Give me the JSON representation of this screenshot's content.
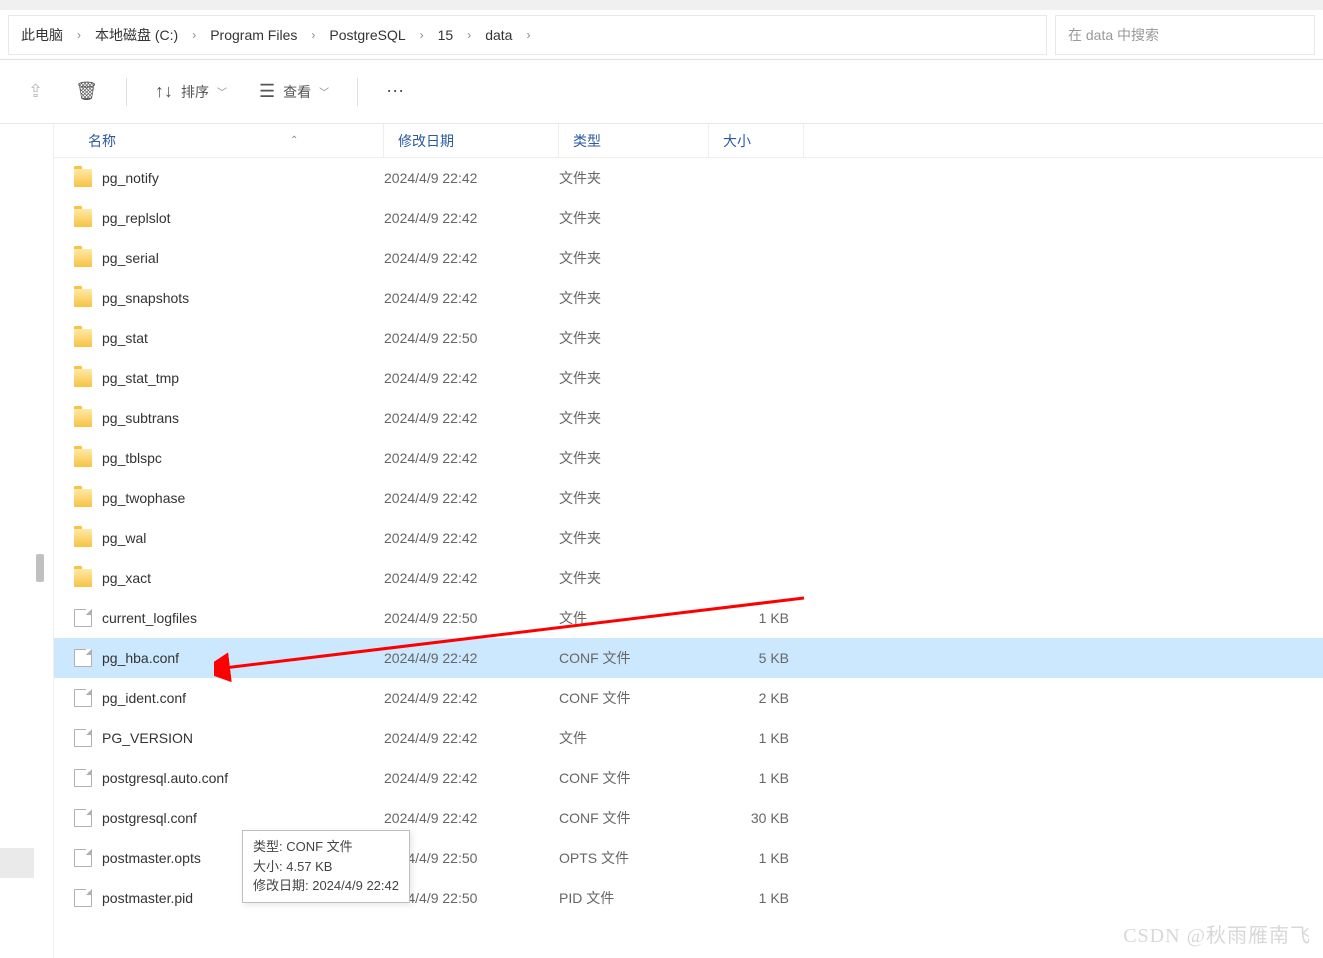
{
  "breadcrumb": [
    {
      "label": "此电脑"
    },
    {
      "label": "本地磁盘 (C:)"
    },
    {
      "label": "Program Files"
    },
    {
      "label": "PostgreSQL"
    },
    {
      "label": "15"
    },
    {
      "label": "data"
    }
  ],
  "search": {
    "placeholder": "在 data 中搜索"
  },
  "toolbar": {
    "sort": "排序",
    "view": "查看"
  },
  "columns": {
    "name": "名称",
    "modified": "修改日期",
    "type": "类型",
    "size": "大小"
  },
  "rows": [
    {
      "icon": "folder",
      "name": "pg_notify",
      "date": "2024/4/9 22:42",
      "type": "文件夹",
      "size": ""
    },
    {
      "icon": "folder",
      "name": "pg_replslot",
      "date": "2024/4/9 22:42",
      "type": "文件夹",
      "size": ""
    },
    {
      "icon": "folder",
      "name": "pg_serial",
      "date": "2024/4/9 22:42",
      "type": "文件夹",
      "size": ""
    },
    {
      "icon": "folder",
      "name": "pg_snapshots",
      "date": "2024/4/9 22:42",
      "type": "文件夹",
      "size": ""
    },
    {
      "icon": "folder",
      "name": "pg_stat",
      "date": "2024/4/9 22:50",
      "type": "文件夹",
      "size": ""
    },
    {
      "icon": "folder",
      "name": "pg_stat_tmp",
      "date": "2024/4/9 22:42",
      "type": "文件夹",
      "size": ""
    },
    {
      "icon": "folder",
      "name": "pg_subtrans",
      "date": "2024/4/9 22:42",
      "type": "文件夹",
      "size": ""
    },
    {
      "icon": "folder",
      "name": "pg_tblspc",
      "date": "2024/4/9 22:42",
      "type": "文件夹",
      "size": ""
    },
    {
      "icon": "folder",
      "name": "pg_twophase",
      "date": "2024/4/9 22:42",
      "type": "文件夹",
      "size": ""
    },
    {
      "icon": "folder",
      "name": "pg_wal",
      "date": "2024/4/9 22:42",
      "type": "文件夹",
      "size": ""
    },
    {
      "icon": "folder",
      "name": "pg_xact",
      "date": "2024/4/9 22:42",
      "type": "文件夹",
      "size": ""
    },
    {
      "icon": "file",
      "name": "current_logfiles",
      "date": "2024/4/9 22:50",
      "type": "文件",
      "size": "1 KB"
    },
    {
      "icon": "file",
      "name": "pg_hba.conf",
      "date": "2024/4/9 22:42",
      "type": "CONF 文件",
      "size": "5 KB",
      "selected": true
    },
    {
      "icon": "file",
      "name": "pg_ident.conf",
      "date": "2024/4/9 22:42",
      "type": "CONF 文件",
      "size": "2 KB"
    },
    {
      "icon": "file",
      "name": "PG_VERSION",
      "date": "2024/4/9 22:42",
      "type": "文件",
      "size": "1 KB"
    },
    {
      "icon": "file",
      "name": "postgresql.auto.conf",
      "date": "2024/4/9 22:42",
      "type": "CONF 文件",
      "size": "1 KB"
    },
    {
      "icon": "file",
      "name": "postgresql.conf",
      "date": "2024/4/9 22:42",
      "type": "CONF 文件",
      "size": "30 KB"
    },
    {
      "icon": "file",
      "name": "postmaster.opts",
      "date": "2024/4/9 22:50",
      "type": "OPTS 文件",
      "size": "1 KB"
    },
    {
      "icon": "file",
      "name": "postmaster.pid",
      "date": "2024/4/9 22:50",
      "type": "PID 文件",
      "size": "1 KB"
    }
  ],
  "tooltip": {
    "line1": "类型: CONF 文件",
    "line2": "大小: 4.57 KB",
    "line3": "修改日期: 2024/4/9 22:42"
  },
  "watermark": "CSDN @秋雨雁南飞"
}
